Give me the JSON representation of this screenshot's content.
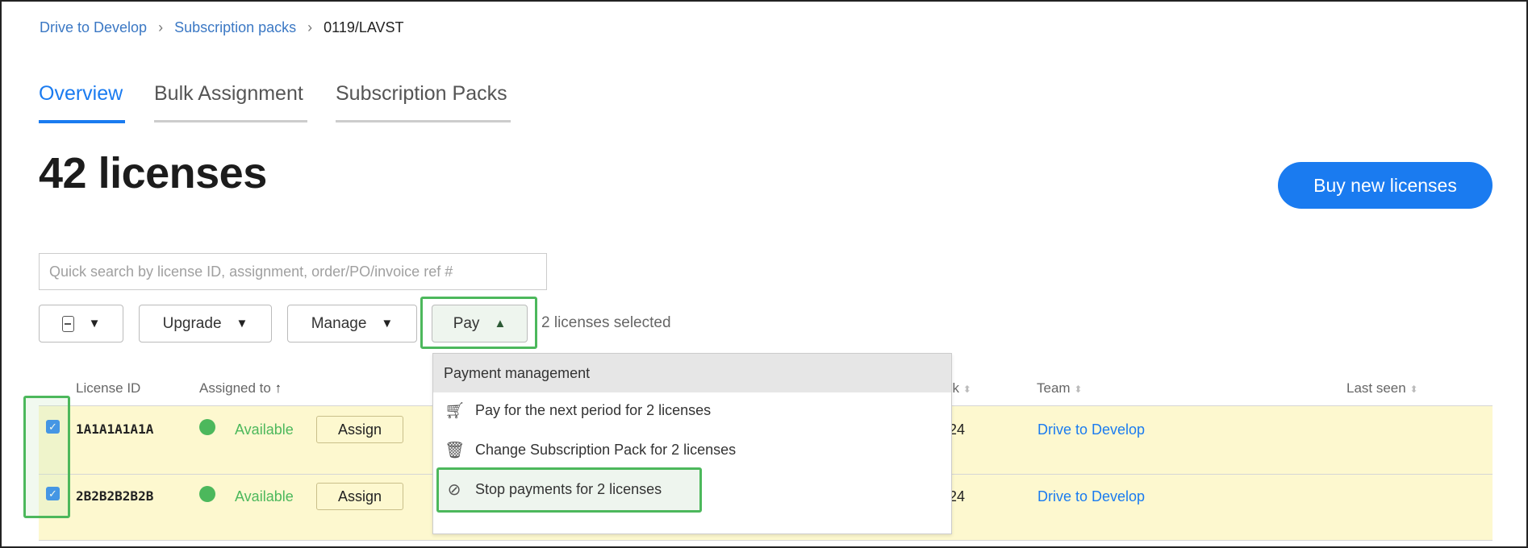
{
  "breadcrumb": [
    "Drive to Develop",
    "Subscription packs",
    "0119/LAVST"
  ],
  "tabs": [
    {
      "label": "Overview",
      "active": true
    },
    {
      "label": "Bulk Assignment"
    },
    {
      "label": "Subscription Packs"
    }
  ],
  "title": "42 licenses",
  "buy_button": "Buy new licenses",
  "search": {
    "placeholder": "Quick search by license ID, assignment, order/PO/invoice ref #",
    "value": ""
  },
  "toolbar": {
    "upgrade": "Upgrade",
    "manage": "Manage",
    "pay": "Pay",
    "selected_text": "2 licenses selected"
  },
  "columns": {
    "license_id": "License ID",
    "assigned_to": "Assigned to",
    "pack_fragment": "ck",
    "team": "Team",
    "last_seen": "Last seen"
  },
  "rows": [
    {
      "id": "1A1A1A1A1A",
      "checked": true,
      "status": "Available",
      "assign": "Assign",
      "pack_fragment": "24",
      "team": "Drive to Develop",
      "last_seen": ""
    },
    {
      "id": "2B2B2B2B2B",
      "checked": true,
      "status": "Available",
      "assign": "Assign",
      "pack_fragment": "24",
      "team": "Drive to Develop",
      "last_seen": ""
    }
  ],
  "pay_menu": {
    "header": "Payment management",
    "items": [
      {
        "label": "Pay for the next period for 2 licenses",
        "icon": "cart-icon"
      },
      {
        "label": "Change Subscription Pack for 2 licenses",
        "icon": "trash-can-icon"
      },
      {
        "label": "Stop payments for 2 licenses",
        "icon": "prohibited-icon"
      }
    ]
  },
  "colors": {
    "accent": "#1a7bf0",
    "highlight": "#4cb85c",
    "row_selected": "#fdf8cf"
  }
}
